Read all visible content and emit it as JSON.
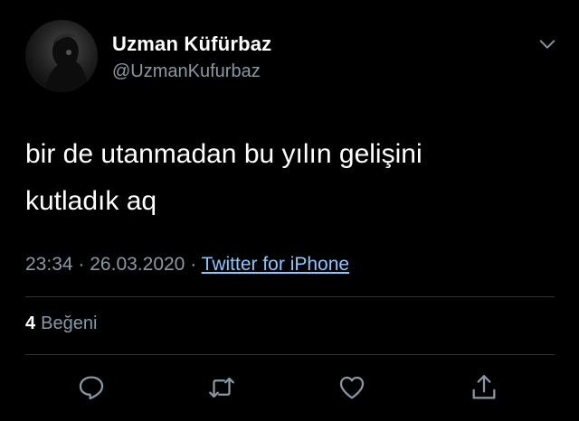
{
  "author": {
    "name": "Uzman Küfürbaz",
    "handle": "@UzmanKufurbaz"
  },
  "tweet": {
    "text_line1": "bir de utanmadan bu yılın gelişini",
    "text_line2": "kutladık aq"
  },
  "meta": {
    "time": "23:34",
    "sep1": "·",
    "date": "26.03.2020",
    "sep2": "·",
    "source": "Twitter for iPhone"
  },
  "likes": {
    "count": "4",
    "label": "Beğeni"
  },
  "icons": {
    "menu": "chevron-down-icon",
    "reply": "reply-icon",
    "retweet": "retweet-icon",
    "like": "heart-icon",
    "share": "share-icon"
  },
  "colors": {
    "background": "#000000",
    "text": "#ffffff",
    "secondary": "#8899a6",
    "link": "#8ec5ff",
    "divider": "#2f3336"
  }
}
